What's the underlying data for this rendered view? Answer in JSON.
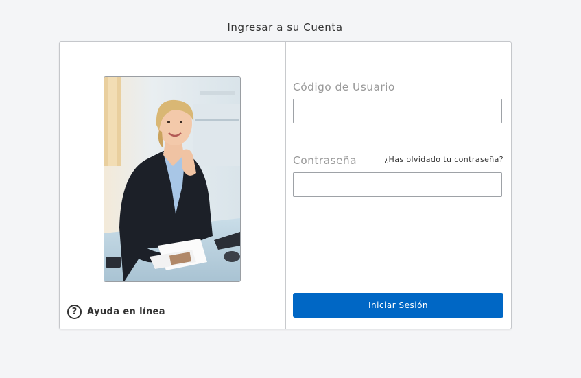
{
  "page": {
    "title": "Ingresar a su Cuenta"
  },
  "help": {
    "icon": "question-circle-icon",
    "label": "Ayuda en línea"
  },
  "photo": {
    "description_icon": "portrait-photo"
  },
  "form": {
    "username": {
      "label": "Código de Usuario",
      "value": "",
      "placeholder": ""
    },
    "password": {
      "label": "Contraseña",
      "value": "",
      "placeholder": ""
    },
    "forgot_password": "¿Has olvidado tu contraseña?",
    "submit_label": "Iniciar Sesión"
  },
  "colors": {
    "accent": "#0067c5",
    "background": "#f4f5f7",
    "label_gray": "#999999"
  }
}
